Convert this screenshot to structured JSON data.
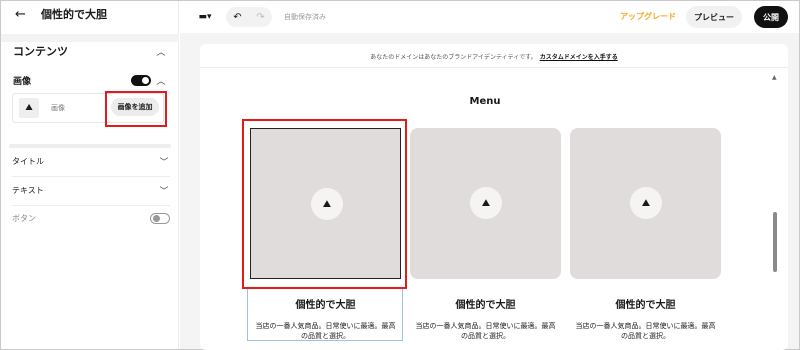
{
  "sidebar": {
    "title": "個性的で大胆",
    "section_title": "コンテンツ",
    "image_label": "画像",
    "image_name": "画像",
    "add_image_button": "画像を追加",
    "accordions": [
      {
        "label": "タイトル"
      },
      {
        "label": "テキスト"
      }
    ],
    "button_label": "ボタン"
  },
  "topbar": {
    "autosave": "自動保存済み",
    "upgrade": "アップグレード",
    "preview": "プレビュー",
    "publish": "公開"
  },
  "canvas": {
    "banner_text": "あなたのドメインはあなたのブランドアイデンティティです。",
    "banner_link": "カスタムドメインを入手する",
    "menu_title": "Menu",
    "cards": [
      {
        "title": "個性的で大胆",
        "text_line1": "当店の一番人気商品。日常使いに最適。最高",
        "text_line2": "の品質と選択。"
      },
      {
        "title": "個性的で大胆",
        "text_line1": "当店の一番人気商品。日常使いに最適。最高",
        "text_line2": "の品質と選択。"
      },
      {
        "title": "個性的で大胆",
        "text_line1": "当店の一番人気商品。日常使いに最適。最高",
        "text_line2": "の品質と選択。"
      }
    ]
  },
  "colors": {
    "accent_orange": "#f5a623",
    "highlight_red": "#e31b1b",
    "card_placeholder": "#e0dcdb"
  },
  "icons": [
    "back-arrow-icon",
    "chevron-up-icon",
    "chevron-down-icon",
    "mountain-image-icon",
    "desktop-device-icon",
    "undo-icon",
    "redo-icon"
  ]
}
